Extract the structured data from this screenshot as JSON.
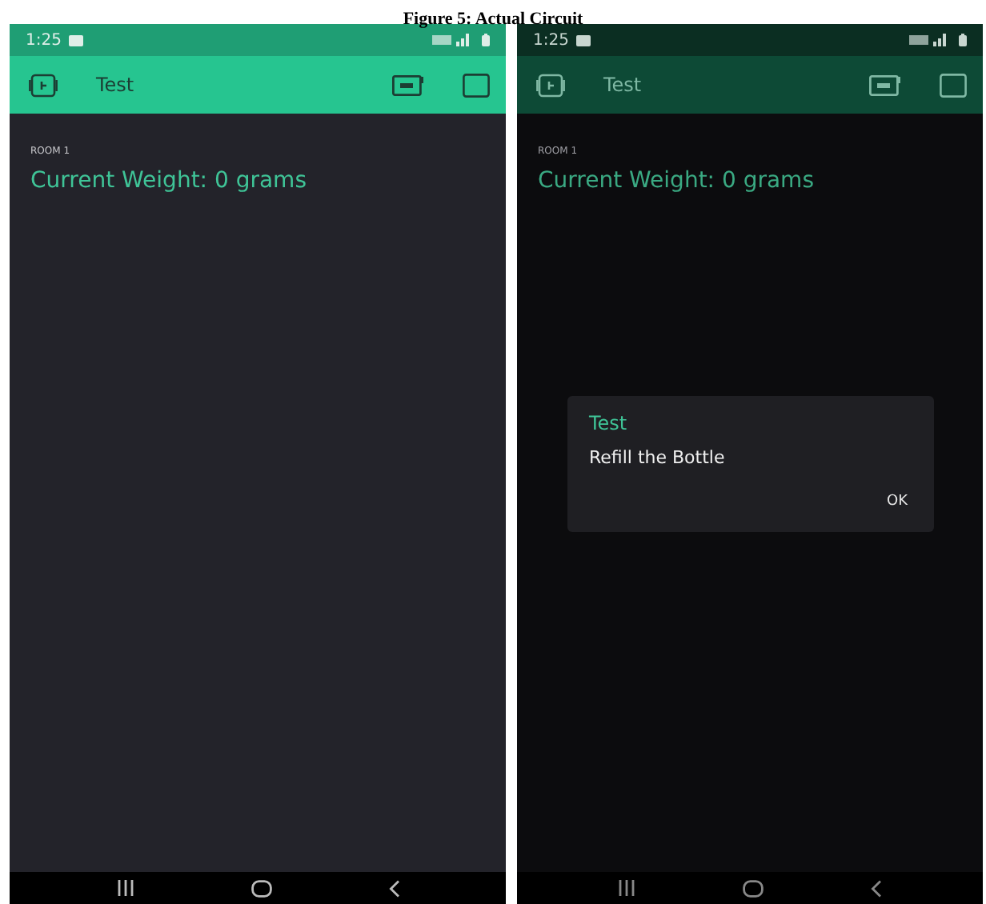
{
  "caption": "Figure 5: Actual Circuit",
  "screens": [
    {
      "status_bar": {
        "time": "1:25"
      },
      "app_bar": {
        "title": "Test"
      },
      "widget": {
        "label": "ROOM 1",
        "value": "Current Weight: 0 grams"
      },
      "dimmed": false
    },
    {
      "status_bar": {
        "time": "1:25"
      },
      "app_bar": {
        "title": "Test"
      },
      "widget": {
        "label": "ROOM 1",
        "value": "Current Weight: 0 grams"
      },
      "dimmed": true,
      "dialog": {
        "title": "Test",
        "message": "Refill the Bottle",
        "button": "OK"
      }
    }
  ]
}
